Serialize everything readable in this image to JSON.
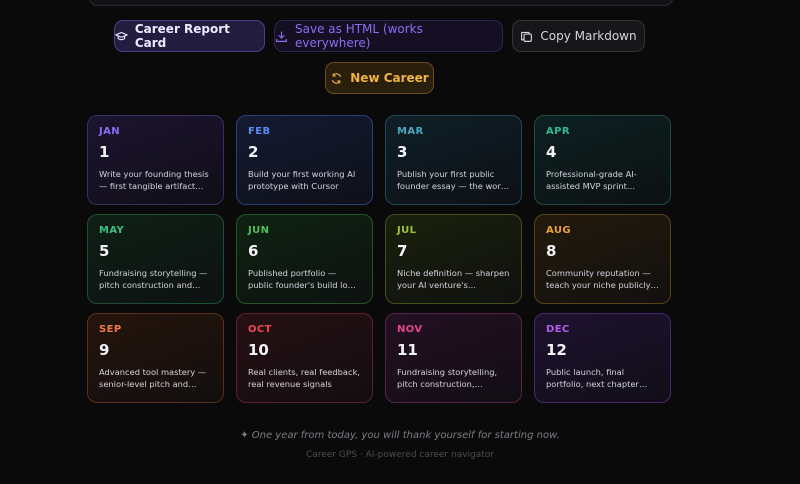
{
  "actions": {
    "report_label": "Career Report Card",
    "html_label": "Save as HTML (works everywhere)",
    "markdown_label": "Copy Markdown",
    "new_label": "New Career"
  },
  "months": [
    {
      "month": "JAN",
      "num": "1",
      "desc": "Write your founding thesis — first tangible artifact exists",
      "accent": "#8b6cf7",
      "bg": "#1c1430",
      "border": "#3a2d66"
    },
    {
      "month": "FEB",
      "num": "2",
      "desc": "Build your first working AI prototype with Cursor",
      "accent": "#5a8cf2",
      "bg": "#141a33",
      "border": "#2d3f78"
    },
    {
      "month": "MAR",
      "num": "3",
      "desc": "Publish your first public founder essay — the world sees your thinking",
      "accent": "#4fa6c4",
      "bg": "#0f1f27",
      "border": "#1f4a5a"
    },
    {
      "month": "APR",
      "num": "4",
      "desc": "Professional-grade AI-assisted MVP sprint workflow",
      "accent": "#34b89a",
      "bg": "#0d2020",
      "border": "#1f4d45"
    },
    {
      "month": "MAY",
      "num": "5",
      "desc": "Fundraising storytelling — pitch construction and investor narrative",
      "accent": "#3fbf7f",
      "bg": "#0e2016",
      "border": "#1f4f32"
    },
    {
      "month": "JUN",
      "num": "6",
      "desc": "Published portfolio — public founder's build log goes live",
      "accent": "#4cc15a",
      "bg": "#0f2212",
      "border": "#265628"
    },
    {
      "month": "JUL",
      "num": "7",
      "desc": "Niche definition — sharpen your AI venture's defensible position",
      "accent": "#9ec23a",
      "bg": "#1a200c",
      "border": "#42501c"
    },
    {
      "month": "AUG",
      "num": "8",
      "desc": "Community reputation — teach your niche publicly, earn trust",
      "accent": "#e8a23a",
      "bg": "#231a0c",
      "border": "#5a421a"
    },
    {
      "month": "SEP",
      "num": "9",
      "desc": "Advanced tool mastery — senior-level pitch and presentation",
      "accent": "#f07a45",
      "bg": "#25140c",
      "border": "#5c2f1a"
    },
    {
      "month": "OCT",
      "num": "10",
      "desc": "Real clients, real feedback, real revenue signals",
      "accent": "#f0464f",
      "bg": "#261014",
      "border": "#5e2128"
    },
    {
      "month": "NOV",
      "num": "11",
      "desc": "Fundraising storytelling, pitch construction, investor pursuit",
      "accent": "#e2458a",
      "bg": "#241022",
      "border": "#58234a"
    },
    {
      "month": "DEC",
      "num": "12",
      "desc": "Public launch, final portfolio, next chapter positioning",
      "accent": "#b45cf0",
      "bg": "#1e1230",
      "border": "#48276e"
    }
  ],
  "quote": "✦ One year from today, you will thank yourself for starting now.",
  "footer": "Career GPS · AI-powered career navigator"
}
